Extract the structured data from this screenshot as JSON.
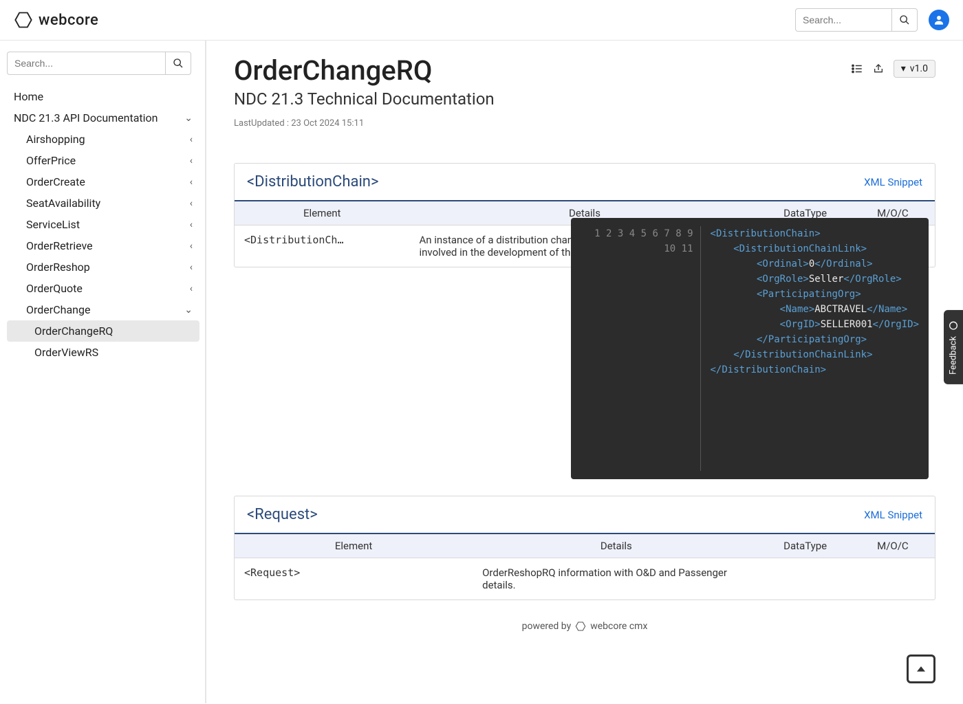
{
  "brand": {
    "name": "webcore"
  },
  "topSearch": {
    "placeholder": "Search..."
  },
  "sideSearch": {
    "placeholder": "Search..."
  },
  "version": "v1.0",
  "sidebar": {
    "home": "Home",
    "root": "NDC 21.3 API Documentation",
    "items": [
      {
        "label": "Airshopping"
      },
      {
        "label": "OfferPrice"
      },
      {
        "label": "OrderCreate"
      },
      {
        "label": "SeatAvailability"
      },
      {
        "label": "ServiceList"
      },
      {
        "label": "OrderRetrieve"
      },
      {
        "label": "OrderReshop"
      },
      {
        "label": "OrderQuote"
      },
      {
        "label": "OrderChange"
      }
    ],
    "sub": [
      {
        "label": "OrderChangeRQ"
      },
      {
        "label": "OrderViewRS"
      }
    ]
  },
  "page": {
    "title": "OrderChangeRQ",
    "subtitle": "NDC 21.3 Technical Documentation",
    "meta": "LastUpdated : 23 Oct 2024 15:11"
  },
  "tableHead": {
    "element": "Element",
    "details": "Details",
    "datatype": "DataType",
    "moc": "M/O/C"
  },
  "section1": {
    "title": "<DistributionChain>",
    "xml": "XML Snippet",
    "row": {
      "element": "<DistributionCh…",
      "details": "An instance of a distribution channel. That is, the set of organisations involved in the development of the current transaction."
    },
    "code": {
      "lines": [
        "1",
        "2",
        "3",
        "4",
        "5",
        "6",
        "7",
        "8",
        "9",
        "10",
        "11"
      ],
      "l1o": "<",
      "l1t": "DistributionChain",
      "l1c": ">",
      "l2o": "<",
      "l2t": "DistributionChainLink",
      "l2c": ">",
      "l3o": "<",
      "l3t": "Ordinal",
      "l3c": ">",
      "l3v": "0",
      "l3co": "</",
      "l3cc": ">",
      "l4o": "<",
      "l4t": "OrgRole",
      "l4c": ">",
      "l4v": "Seller",
      "l4co": "</",
      "l4cc": ">",
      "l5o": "<",
      "l5t": "ParticipatingOrg",
      "l5c": ">",
      "l6o": "<",
      "l6t": "Name",
      "l6c": ">",
      "l6v": "ABCTRAVEL",
      "l6co": "</",
      "l6cc": ">",
      "l7o": "<",
      "l7t": "OrgID",
      "l7c": ">",
      "l7v": "SELLER001",
      "l7co": "</",
      "l7cc": ">",
      "l8o": "</",
      "l8t": "ParticipatingOrg",
      "l8c": ">",
      "l9o": "</",
      "l9t": "DistributionChainLink",
      "l9c": ">",
      "l10o": "</",
      "l10t": "DistributionChain",
      "l10c": ">"
    }
  },
  "section2": {
    "title": "<Request>",
    "xml": "XML Snippet",
    "row": {
      "element": "<Request>",
      "details": "OrderReshopRQ information with O&D and Passenger details."
    }
  },
  "footer": {
    "prefix": "powered by",
    "name": "webcore cmx"
  },
  "feedback": "Feedback"
}
